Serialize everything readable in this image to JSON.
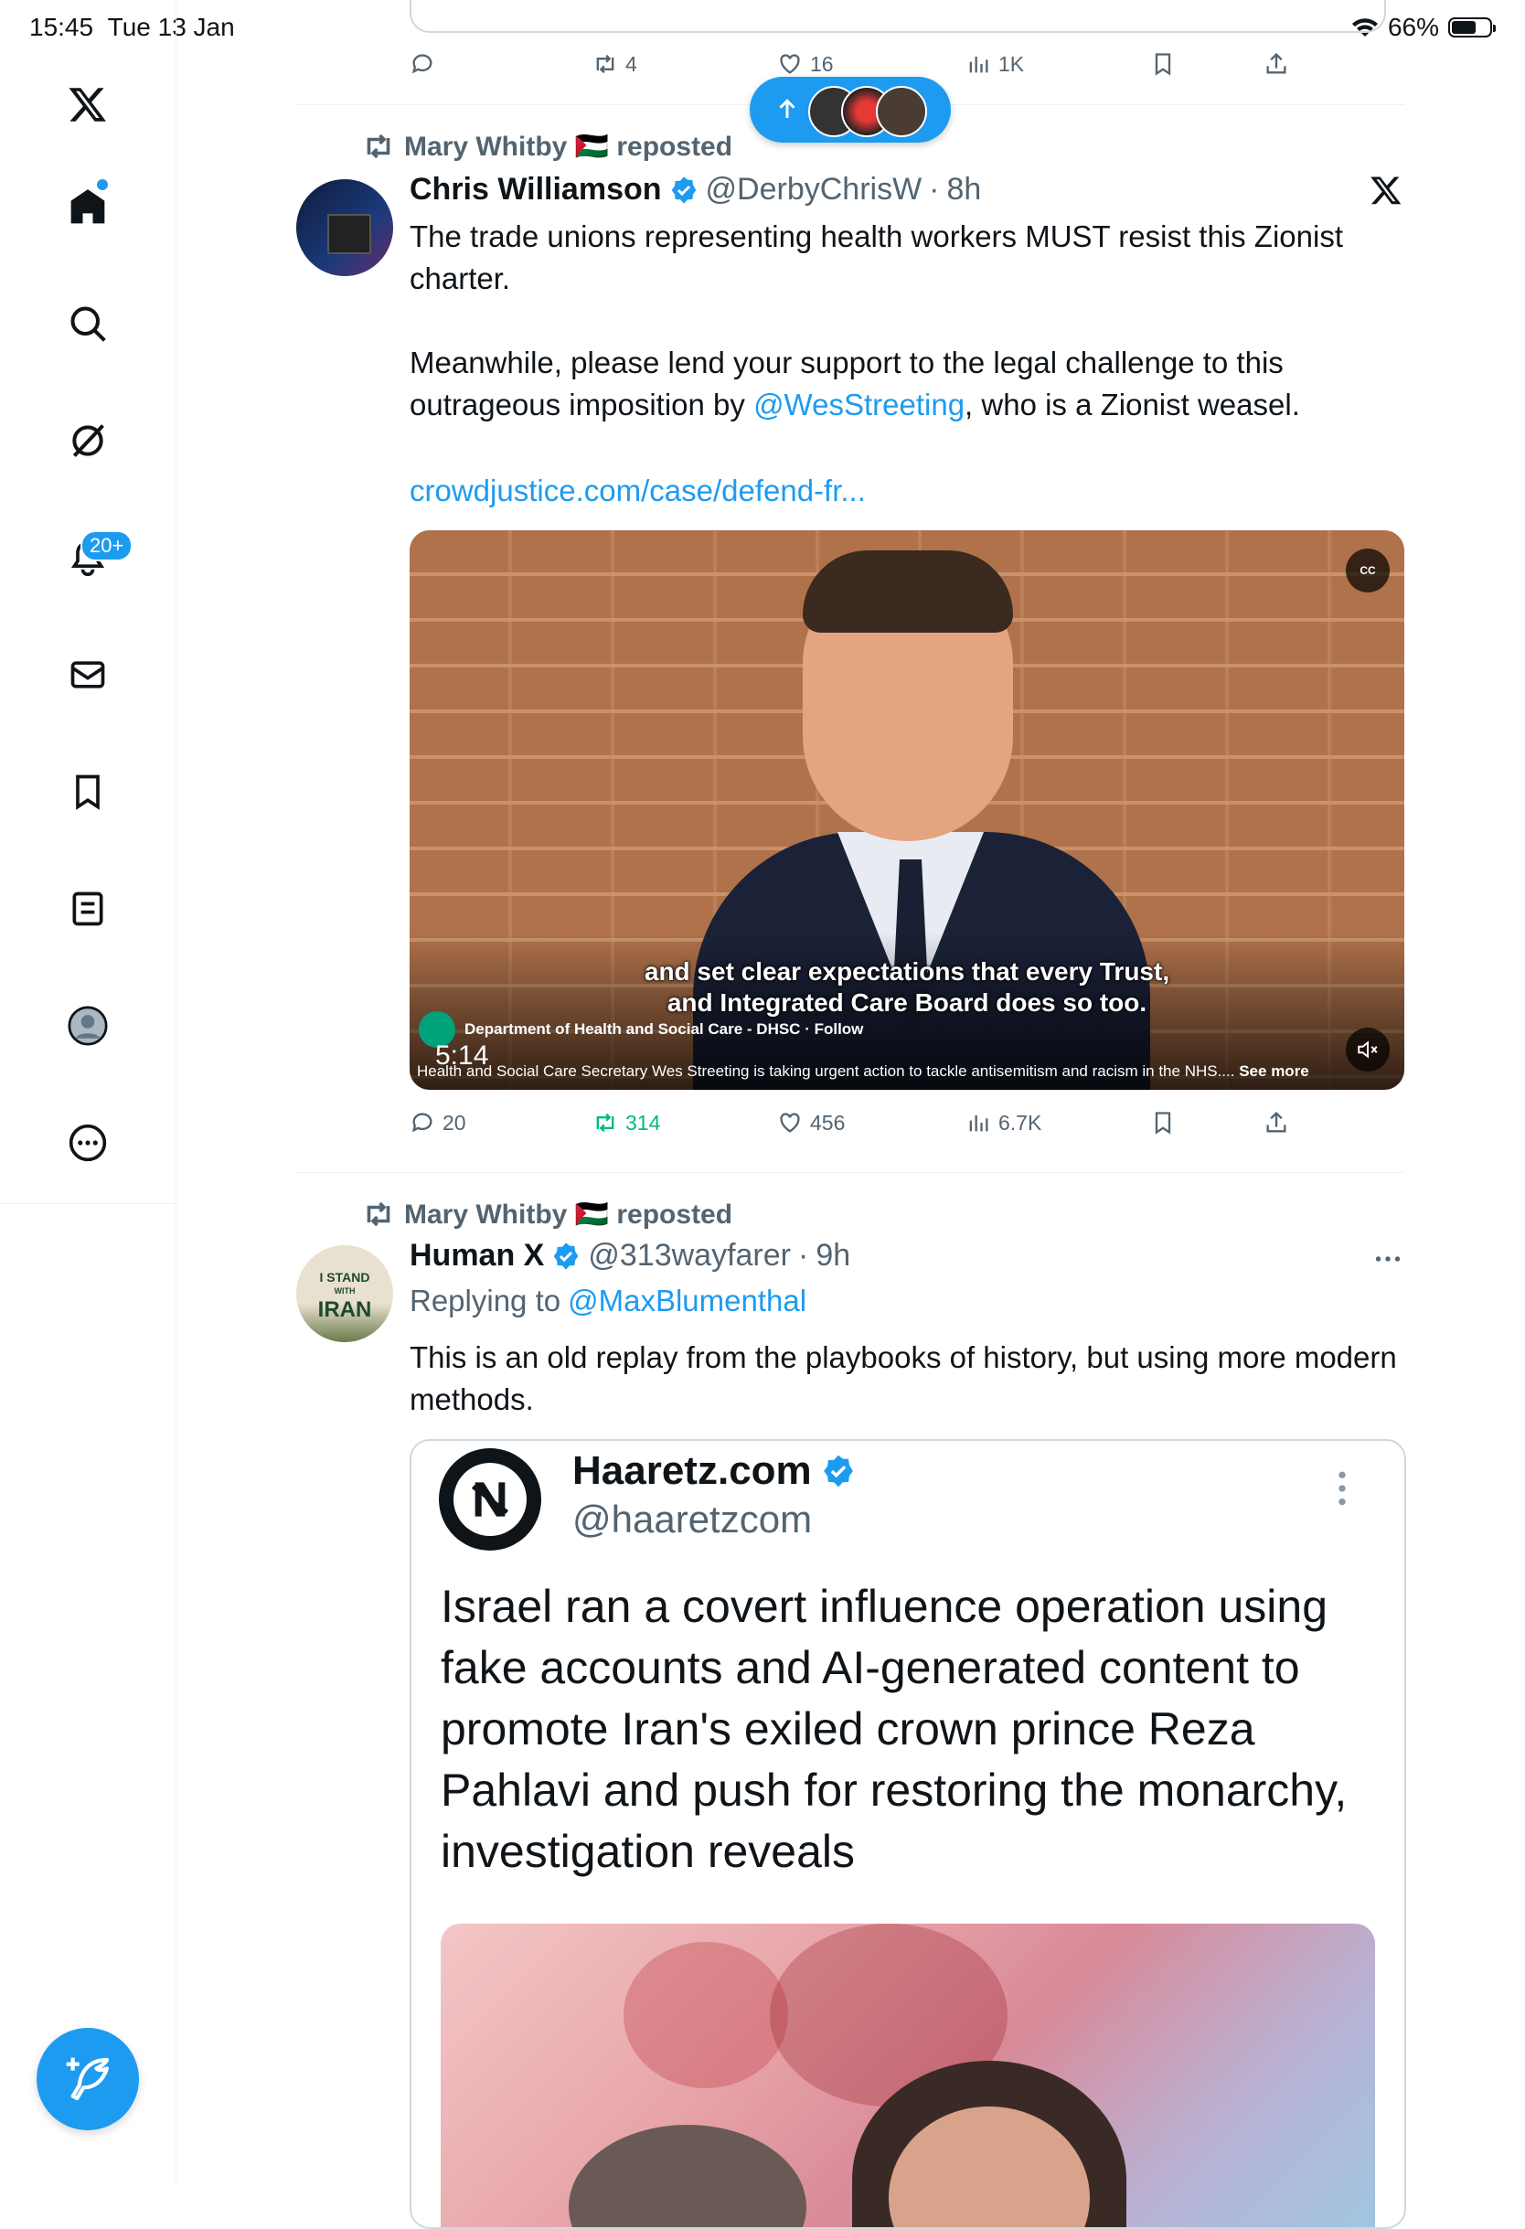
{
  "status_bar": {
    "time": "15:45",
    "date": "Tue 13 Jan",
    "battery": "66%",
    "battery_level": 0.66
  },
  "sidebar": {
    "items": [
      {
        "icon": "x-logo-icon"
      },
      {
        "icon": "home-icon"
      },
      {
        "icon": "search-icon"
      },
      {
        "icon": "grok-icon"
      },
      {
        "icon": "notifications-icon",
        "badge": "20+"
      },
      {
        "icon": "messages-icon"
      },
      {
        "icon": "bookmarks-icon"
      },
      {
        "icon": "lists-icon"
      },
      {
        "icon": "profile-icon"
      },
      {
        "icon": "more-icon"
      }
    ],
    "compose_icon": "compose-post-icon"
  },
  "previous_tweet_actions": {
    "replies": "",
    "reposts": "4",
    "likes": "16",
    "views": "1K"
  },
  "new_posts_pill": {
    "icon": "arrow-up-icon"
  },
  "tweet1": {
    "reposted_by": "Mary Whitby 🇵🇸 reposted",
    "name": "Chris Williamson",
    "handle": "@DerbyChrisW",
    "time": "8h",
    "text1": "The trade unions representing health workers MUST resist this Zionist charter.",
    "text2_a": "Meanwhile, please lend your support to the legal challenge to this outrageous imposition by ",
    "text2_mention": "@WesStreeting",
    "text2_b": ", who is a Zionist weasel.",
    "link": "crowdjustice.com/case/defend-fr...",
    "video": {
      "caption_line1": "and set clear expectations that every Trust,",
      "caption_line2": "and Integrated Care Board does so too.",
      "cc": "CC",
      "source": "Department of Health and Social Care - DHSC",
      "follow": "Follow",
      "duration": "5:14",
      "description": "Health and Social Care Secretary Wes Streeting is taking urgent action to tackle antisemitism and racism in the NHS....",
      "see_more": "See more"
    },
    "actions": {
      "replies": "20",
      "reposts": "314",
      "likes": "456",
      "views": "6.7K"
    }
  },
  "tweet2": {
    "reposted_by": "Mary Whitby 🇵🇸 reposted",
    "name": "Human X",
    "handle": "@313wayfarer",
    "time": "9h",
    "replying_label": "Replying to ",
    "replying_to": "@MaxBlumenthal",
    "text": "This is an old replay from the playbooks of history, but using more modern methods.",
    "avatar_text_1": "I STAND",
    "avatar_text_2": "WITH",
    "avatar_text_3": "IRAN",
    "quote": {
      "name": "Haaretz.com",
      "handle": "@haaretzcom",
      "text": "Israel ran a covert influence operation using fake accounts and AI-generated content to promote Iran's exiled crown prince Reza Pahlavi and push for restoring the monarchy, investigation reveals"
    }
  }
}
